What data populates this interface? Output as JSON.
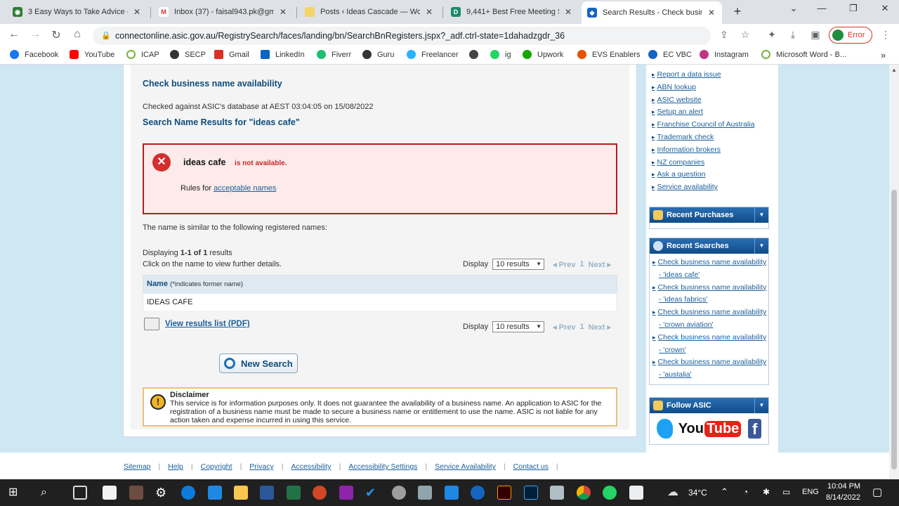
{
  "browser": {
    "tabs": [
      {
        "title": "3 Easy Ways to Take Advice -",
        "color": "#2e7d32",
        "glyph": "◉"
      },
      {
        "title": "Inbox (37) - faisal943.pk@gm",
        "color": "#d93025",
        "glyph": "M"
      },
      {
        "title": "Posts ‹ Ideas Cascade — Wo",
        "color": "#f6d365",
        "glyph": ""
      },
      {
        "title": "9,441+ Best Free Meeting St",
        "color": "#1b8a6b",
        "glyph": "D"
      },
      {
        "title": "Search Results - Check busin",
        "color": "#1565c0",
        "glyph": "◆"
      }
    ],
    "url": "connectonline.asic.gov.au/RegistrySearch/faces/landing/bn/SearchBnRegisters.jspx?_adf.ctrl-state=1dahadzgdr_36",
    "error_label": "Error",
    "bookmarks": [
      {
        "label": "Facebook",
        "color": "#1877f2"
      },
      {
        "label": "YouTube",
        "color": "#ff0000"
      },
      {
        "label": "ICAP",
        "color": "#7cb342"
      },
      {
        "label": "SECP",
        "color": "#333333"
      },
      {
        "label": "Gmail",
        "color": "#d93025"
      },
      {
        "label": "LinkedIn",
        "color": "#0a66c2"
      },
      {
        "label": "Fiverr",
        "color": "#1dbf73"
      },
      {
        "label": "Guru",
        "color": "#333333"
      },
      {
        "label": "Freelancer",
        "color": "#29b2fe"
      },
      {
        "label": "",
        "color": "#444444"
      },
      {
        "label": "ig",
        "color": "#25d366"
      },
      {
        "label": "Upwork",
        "color": "#14a800"
      },
      {
        "label": "EVS Enablers",
        "color": "#e65100"
      },
      {
        "label": "EC VBC",
        "color": "#1565c0"
      },
      {
        "label": "Instagram",
        "color": "#c13584"
      },
      {
        "label": "Microsoft Word - B...",
        "color": "#7cb342"
      }
    ]
  },
  "main": {
    "title": "Check business name availability",
    "checked": "Checked against ASIC's database at AEST 03:04:05 on 15/08/2022",
    "results_heading": "Search Name Results for \"ideas cafe\"",
    "result_name": "ideas cafe",
    "result_status": "is not available.",
    "rules_prefix": "Rules for ",
    "rules_link": "acceptable names",
    "similar_text": "The name is similar to the following registered names:",
    "displaying_prefix": "Displaying ",
    "displaying_range": "1-1 of 1",
    "displaying_suffix": " results",
    "click_hint": "Click on the name to view further details.",
    "display_label": "Display",
    "display_value": "10 results",
    "prev": "◂ Prev",
    "page_num": "1",
    "next": "Next ▸",
    "col_name": "Name",
    "col_note": "(*indicates former name)",
    "rows": [
      "IDEAS CAFE"
    ],
    "pdf_link": "View results list (PDF)",
    "new_search": "New Search",
    "disclaimer_title": "Disclaimer",
    "disclaimer_text": "This service is for information purposes only. It does not guarantee the availability of a business name. An application to ASIC for the registration of a business name must be made to secure a business name or entitlement to use the name. ASIC is not liable for any action taken and expense incurred in using this service."
  },
  "sidebar": {
    "links": [
      "Report a data issue",
      "ABN lookup",
      "ASIC website",
      "Setup an alert",
      "Franchise Council of Australia",
      "Trademark check",
      "Information brokers",
      "NZ companies",
      "Ask a question",
      "Service availability"
    ],
    "recent_purchases": "Recent Purchases",
    "recent_searches": "Recent Searches",
    "searches": [
      {
        "label": "Check business name availability",
        "term": "- 'ideas cafe'"
      },
      {
        "label": "Check business name availability",
        "term": "- 'ideas fabrics'"
      },
      {
        "label": "Check business name availability",
        "term": "- 'crown aviation'"
      },
      {
        "label": "Check business name availability",
        "term": "- 'crown'"
      },
      {
        "label": "Check business name availability",
        "term": "- 'austalia'"
      }
    ],
    "follow": "Follow ASIC",
    "youtube_you": "You",
    "youtube_tube": "Tube",
    "facebook_f": "f"
  },
  "footer": {
    "links": [
      "Sitemap",
      "Help",
      "Copyright",
      "Privacy",
      "Accessibility",
      "Accessibility Settings",
      "Service Availability",
      "Contact us"
    ]
  },
  "taskbar": {
    "temp": "34°C",
    "lang": "ENG",
    "time": "10:04 PM",
    "date": "8/14/2022"
  }
}
